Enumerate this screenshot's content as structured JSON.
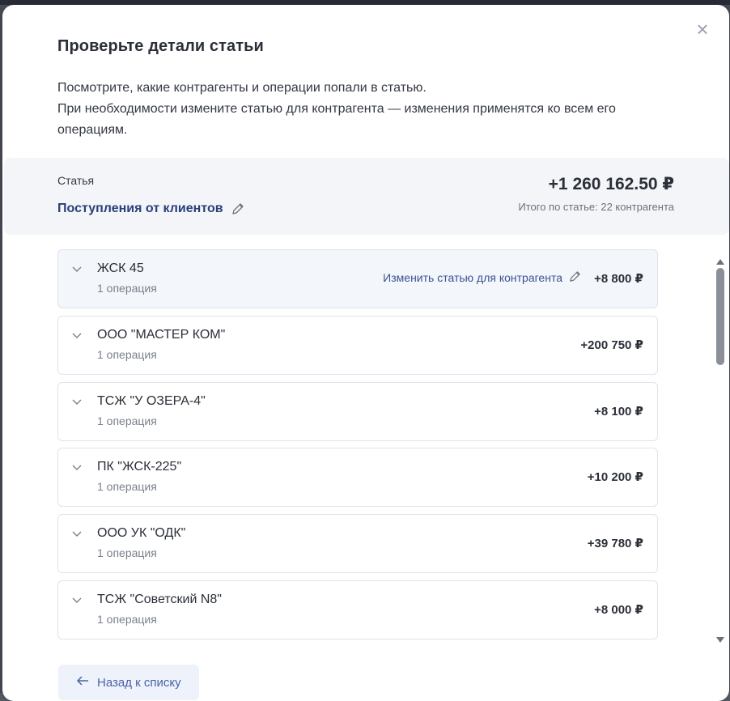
{
  "modal": {
    "title": "Проверьте детали статьи",
    "description_line1": "Посмотрите, какие контрагенты и операции попали в статью.",
    "description_line2": "При необходимости измените статью для контрагента — изменения применятся ко всем его операциям.",
    "close_icon": "close-icon"
  },
  "summary": {
    "label": "Статья",
    "category": "Поступления от клиентов",
    "total": "+1 260 162.50 ₽",
    "total_sub": "Итого по статье: 22 контрагента"
  },
  "rows": [
    {
      "name": "ЖСК 45",
      "ops": "1 операция",
      "amount": "+8 800 ₽",
      "change_label": "Изменить статью для контрагента"
    },
    {
      "name": "ООО \"МАСТЕР КОМ\"",
      "ops": "1 операция",
      "amount": "+200 750 ₽"
    },
    {
      "name": "ТСЖ \"У ОЗЕРА-4\"",
      "ops": "1 операция",
      "amount": "+8 100 ₽"
    },
    {
      "name": "ПК \"ЖСК-225\"",
      "ops": "1 операция",
      "amount": "+10 200 ₽"
    },
    {
      "name": "ООО УК \"ОДК\"",
      "ops": "1 операция",
      "amount": "+39 780 ₽"
    },
    {
      "name": "ТСЖ \"Советский N8\"",
      "ops": "1 операция",
      "amount": "+8 000 ₽"
    }
  ],
  "footer": {
    "back_label": "Назад к списку"
  },
  "colors": {
    "accent": "#28407a",
    "link": "#3a5391",
    "summary_bg": "#f3f5f9"
  }
}
